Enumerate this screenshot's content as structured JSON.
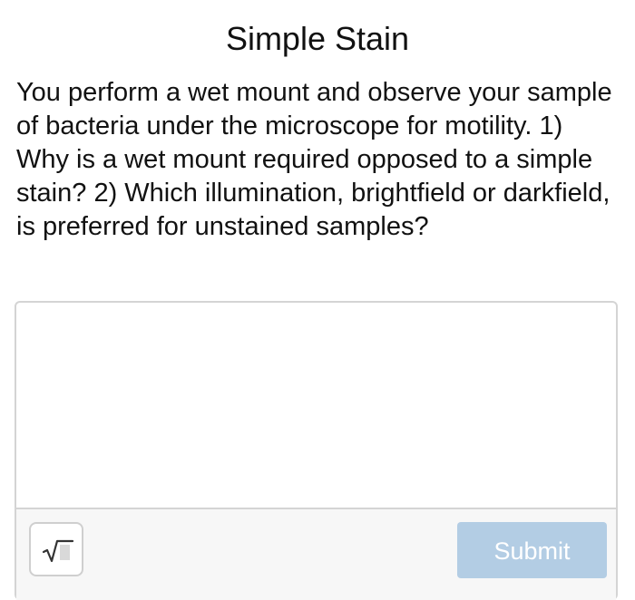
{
  "header": {
    "title": "Simple Stain"
  },
  "question": {
    "text": "You perform a wet mount and observe your sample of bacteria under the microscope for motility. 1) Why is a wet mount required opposed to a simple stain? 2) Which illumination, brightfield or darkfield, is preferred for unstained samples?"
  },
  "answer": {
    "value": "",
    "placeholder": ""
  },
  "toolbar": {
    "math_icon": "square-root-icon",
    "submit_label": "Submit",
    "submit_color": "#b3cde4",
    "submit_state": "disabled"
  }
}
